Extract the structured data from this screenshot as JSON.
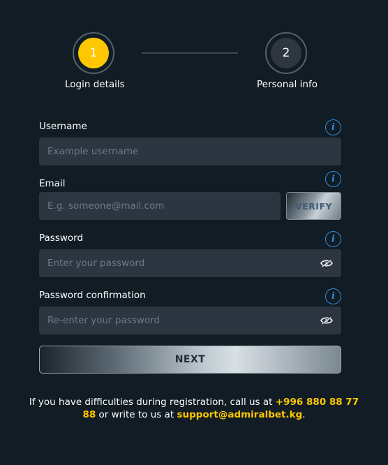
{
  "stepper": {
    "steps": [
      {
        "number": "1",
        "label": "Login details",
        "active": true
      },
      {
        "number": "2",
        "label": "Personal info",
        "active": false
      }
    ]
  },
  "form": {
    "username": {
      "label": "Username",
      "placeholder": "Example username",
      "value": ""
    },
    "email": {
      "label": "Email",
      "placeholder": "E.g. someone@mail.com",
      "value": "",
      "verify_label": "VERIFY"
    },
    "password": {
      "label": "Password",
      "placeholder": "Enter your password",
      "value": ""
    },
    "password_confirmation": {
      "label": "Password confirmation",
      "placeholder": "Re-enter your password",
      "value": ""
    },
    "next_label": "NEXT"
  },
  "footer": {
    "text_before": "If you have difficulties during registration, call us at ",
    "phone": "+996 880 88 77 88",
    "text_middle": " or write to us at ",
    "email": "support@admiralbet.kg",
    "text_after": "."
  },
  "colors": {
    "background": "#111c24",
    "accent": "#ffc700",
    "info": "#2f8de0",
    "input_bg": "#2c3540"
  },
  "icons": {
    "info": "info-icon",
    "visibility": "eye-icon"
  }
}
